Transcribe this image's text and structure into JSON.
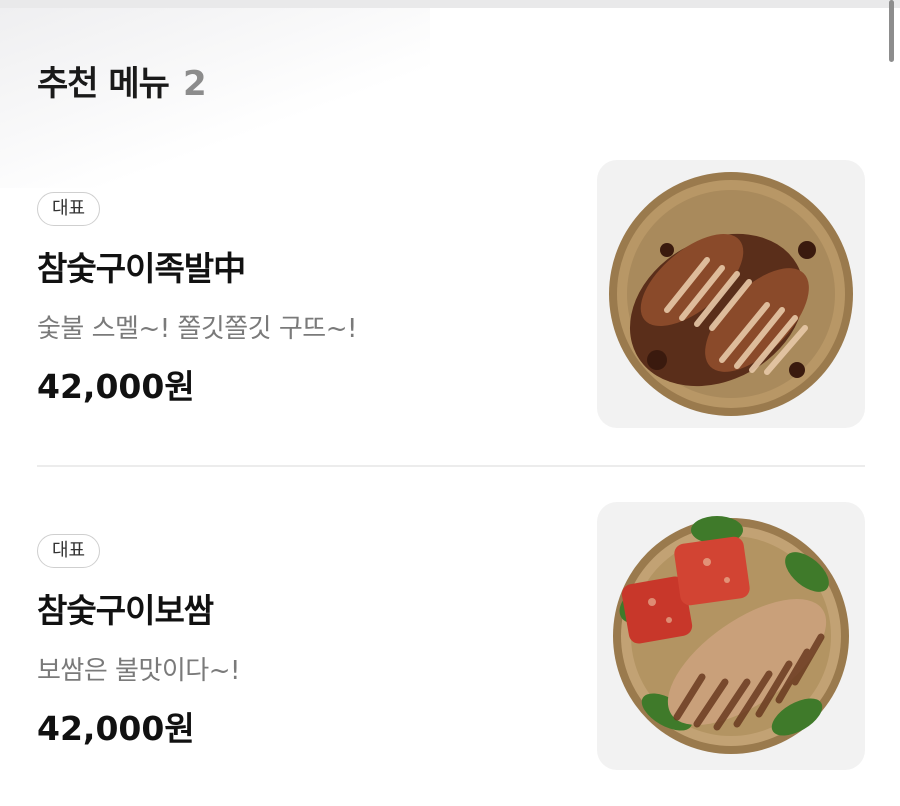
{
  "section": {
    "title": "추천 메뉴",
    "count": "2"
  },
  "items": [
    {
      "badge": "대표",
      "name": "참숯구이족발中",
      "description": "숯불 스멜~! 쫄깃쫄깃 구뜨~!",
      "price": "42,000원",
      "image_icon": "jokbal-plate"
    },
    {
      "badge": "대표",
      "name": "참숯구이보쌈",
      "description": "보쌈은 불맛이다~!",
      "price": "42,000원",
      "image_icon": "bossam-plate"
    }
  ]
}
